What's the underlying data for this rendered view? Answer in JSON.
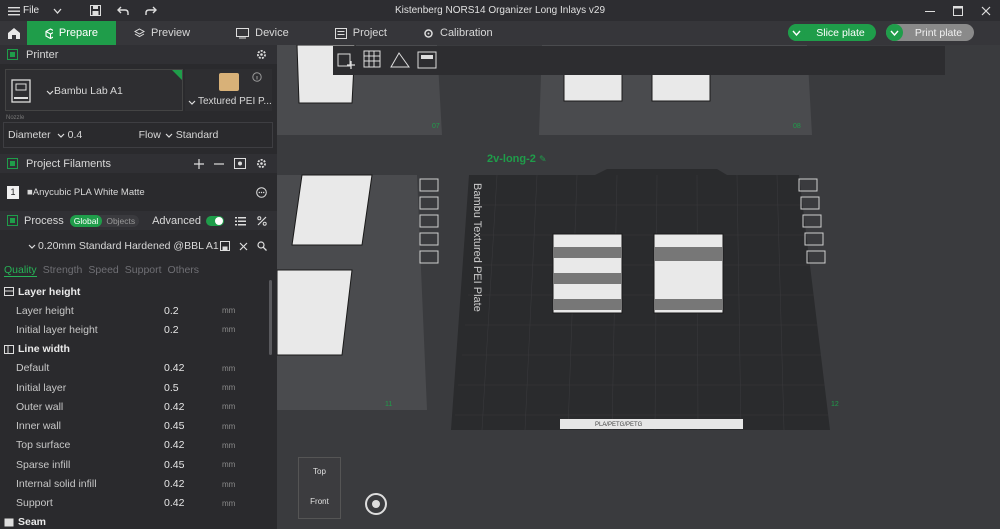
{
  "titlebar": {
    "file_label": "File",
    "title": "Kistenberg NORS14 Organizer Long Inlays v29"
  },
  "tabs": [
    {
      "label": "Prepare",
      "icon": "cube-icon"
    },
    {
      "label": "Preview",
      "icon": "layers-icon"
    },
    {
      "label": "Device",
      "icon": "device-icon"
    },
    {
      "label": "Project",
      "icon": "project-icon"
    },
    {
      "label": "Calibration",
      "icon": "calibration-icon"
    }
  ],
  "actions": {
    "slice_label": "Slice plate",
    "print_label": "Print plate"
  },
  "printer": {
    "section_label": "Printer",
    "name": "Bambu Lab A1",
    "plate": "Textured PEI P...",
    "nozzle_caption": "Nozzle",
    "diameter_label": "Diameter",
    "diameter_value": "0.4",
    "flow_label": "Flow",
    "flow_value": "Standard"
  },
  "filaments": {
    "section_label": "Project Filaments",
    "items": [
      {
        "index": "1",
        "name": "Anycubic PLA White Matte"
      }
    ]
  },
  "process": {
    "section_label": "Process",
    "seg_global": "Global",
    "seg_objects": "Objects",
    "advanced_label": "Advanced",
    "preset": "0.20mm Standard Hardened @BBL A1",
    "tabs": [
      "Quality",
      "Strength",
      "Speed",
      "Support",
      "Others"
    ],
    "groups": [
      {
        "title": "Layer height",
        "rows": [
          {
            "label": "Layer height",
            "value": "0.2",
            "unit": "mm"
          },
          {
            "label": "Initial layer height",
            "value": "0.2",
            "unit": "mm"
          }
        ]
      },
      {
        "title": "Line width",
        "rows": [
          {
            "label": "Default",
            "value": "0.42",
            "unit": "mm"
          },
          {
            "label": "Initial layer",
            "value": "0.5",
            "unit": "mm"
          },
          {
            "label": "Outer wall",
            "value": "0.42",
            "unit": "mm"
          },
          {
            "label": "Inner wall",
            "value": "0.45",
            "unit": "mm"
          },
          {
            "label": "Top surface",
            "value": "0.42",
            "unit": "mm"
          },
          {
            "label": "Sparse infill",
            "value": "0.45",
            "unit": "mm"
          },
          {
            "label": "Internal solid infill",
            "value": "0.42",
            "unit": "mm"
          },
          {
            "label": "Support",
            "value": "0.42",
            "unit": "mm"
          }
        ]
      },
      {
        "title": "Seam",
        "rows": []
      }
    ]
  },
  "viewport": {
    "plate_name": "2v-long-2",
    "plate_text": "Bambu Textured PEI Plate",
    "plate_footer": "PLA/PETG/PETG",
    "plate_numbers": [
      "07",
      "08",
      "11",
      "12"
    ],
    "cube_top": "Top",
    "cube_front": "Front"
  }
}
